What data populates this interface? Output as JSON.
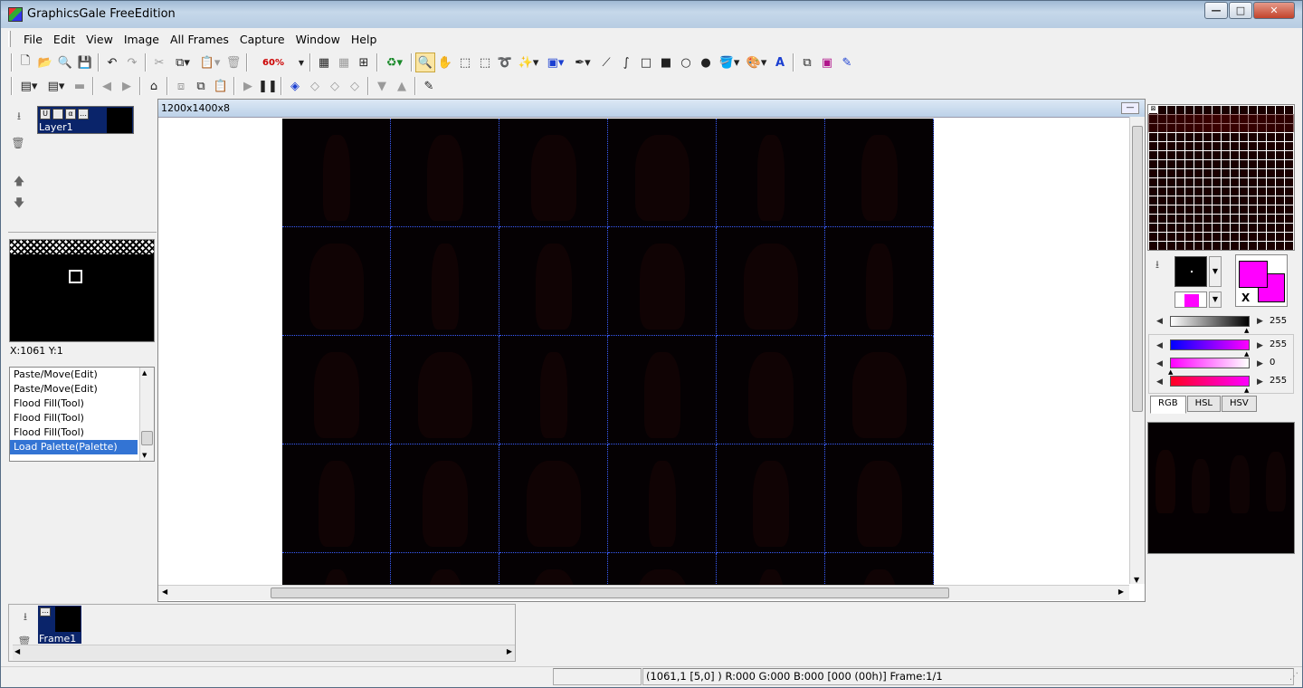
{
  "window": {
    "title": "GraphicsGale FreeEdition",
    "min": "—",
    "max": "□",
    "close": "✕"
  },
  "menu": [
    "File",
    "Edit",
    "View",
    "Image",
    "All Frames",
    "Capture",
    "Window",
    "Help"
  ],
  "toolbar": {
    "zoom": "60%"
  },
  "layers": {
    "items": [
      {
        "label": "Layer1"
      }
    ]
  },
  "coords": "X:1061 Y:1",
  "history": [
    "Paste/Move(Edit)",
    "Paste/Move(Edit)",
    "Flood Fill(Tool)",
    "Flood Fill(Tool)",
    "Flood Fill(Tool)",
    "Load Palette(Palette)"
  ],
  "canvas": {
    "info": "1200x1400x8"
  },
  "palette": {
    "sliders": [
      {
        "value": "255",
        "level": 1.0
      },
      {
        "value": "255",
        "level": 1.0
      },
      {
        "value": "0",
        "level": 0.0
      },
      {
        "value": "255",
        "level": 1.0
      }
    ],
    "tabs": [
      "RGB",
      "HSL",
      "HSV"
    ],
    "active_tab": "RGB",
    "fg_color": "#ff00ff",
    "bg_color": "#ff00ff",
    "swap_label": "X"
  },
  "frames": {
    "items": [
      {
        "label": "Frame1"
      }
    ]
  },
  "status": {
    "pixel": "(1061,1 [5,0] ) R:000 G:000 B:000  [000 (00h)]  Frame:1/1"
  }
}
